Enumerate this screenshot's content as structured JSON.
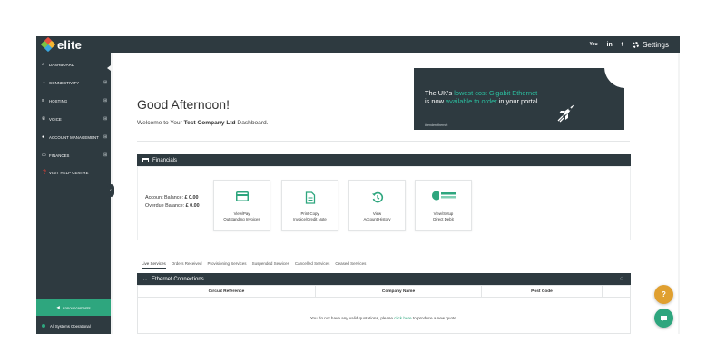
{
  "brand": {
    "name": "elite"
  },
  "topbar": {
    "social": [
      "You",
      "in",
      "t"
    ],
    "settings_label": "Settings"
  },
  "sidebar": {
    "items": [
      {
        "label": "DASHBOARD",
        "icon": "home-icon",
        "expandable": false
      },
      {
        "label": "CONNECTIVITY",
        "icon": "link-icon",
        "expandable": true
      },
      {
        "label": "HOSTING",
        "icon": "server-icon",
        "expandable": true
      },
      {
        "label": "VOICE",
        "icon": "phone-icon",
        "expandable": true
      },
      {
        "label": "ACCOUNT MANAGEMENT",
        "icon": "user-icon",
        "expandable": true
      },
      {
        "label": "FINANCES",
        "icon": "card-icon",
        "expandable": true
      },
      {
        "label": "VISIT HELP CENTRE",
        "icon": "help-icon",
        "expandable": false
      }
    ],
    "plus_symbol": "⊞",
    "announcements_label": "Announcements",
    "status_label": "All Systems Operational"
  },
  "dashboard": {
    "greeting": "Good Afternoon!",
    "welcome_prefix": "Welcome to Your ",
    "company": "Test Company Ltd",
    "welcome_suffix": " Dashboard."
  },
  "banner": {
    "line1_a": "The UK's ",
    "line1_hl": "lowest cost Gigabit Ethernet",
    "line2_a": "is now ",
    "line2_hl": "available to order",
    "line2_b": " in your portal",
    "hashtag": "#tenderethernet"
  },
  "financials": {
    "title": "Financials",
    "account_balance_label": "Account Balance:",
    "account_balance_value": "£ 0.00",
    "overdue_balance_label": "Overdue Balance:",
    "overdue_balance_value": "£ 0.00",
    "tiles": [
      {
        "line1": "View/Pay",
        "line2": "Outstanding Invoices",
        "icon": "card-icon"
      },
      {
        "line1": "Print Copy",
        "line2": "Invoice/Credit Note",
        "icon": "document-icon"
      },
      {
        "line1": "View",
        "line2": "Account History",
        "icon": "history-icon"
      },
      {
        "line1": "View/Setup",
        "line2": "Direct Debit",
        "icon": "direct-debit-icon"
      }
    ]
  },
  "services": {
    "tabs": [
      "Live Services",
      "Orders Received",
      "Provisioning Services",
      "Suspended Services",
      "Cancelled Services",
      "Ceased Services"
    ],
    "active_tab": 0
  },
  "ethernet": {
    "title": "Ethernet Connections",
    "columns": [
      "Circuit Reference",
      "Company Name",
      "Post Code",
      ""
    ],
    "empty_prefix": "You do not have any valid quotations, please ",
    "empty_link": "click here",
    "empty_suffix": " to produce a new quote."
  },
  "colors": {
    "dark": "#2e3a40",
    "accent": "#2ea67e",
    "help": "#e0a030",
    "chat": "#2ea67e",
    "banner_highlight": "#2bc0a0"
  },
  "floating": {
    "help_label": "?",
    "chat_icon": "chat-icon"
  }
}
